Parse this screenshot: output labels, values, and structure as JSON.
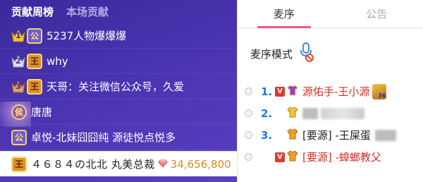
{
  "left_tabs": {
    "contribution_week": "贡献周榜",
    "this_show": "本场贡献"
  },
  "ranking": [
    {
      "rank": "1",
      "level_icon": "crown-badge",
      "level_text": "公",
      "name": "5237人物爆爆爆"
    },
    {
      "rank": "2",
      "level_icon": "king-badge",
      "level_text": "王",
      "name": "why"
    },
    {
      "rank": "3",
      "level_icon": "king-badge",
      "level_text": "王",
      "name": "天哥：关注微信公众号，久爱"
    },
    {
      "rank": "",
      "level_icon": "marquis-badge",
      "level_text": "侯",
      "name": "唐唐"
    },
    {
      "rank": "",
      "level_icon": "duke-badge",
      "level_text": "公",
      "name": "卓悦-北妹囧囧纯 源徒悦点悦多"
    }
  ],
  "my_row": {
    "level_text": "王",
    "name": "４６８４の北北 丸美总裁",
    "gem_icon": "gem-icon",
    "score": "34,656,800"
  },
  "right_tabs": {
    "queue": "麦序",
    "notice": "公告"
  },
  "mode": {
    "label": "麦序模式",
    "icon": "mic-icon",
    "status_icon": "disabled-icon"
  },
  "queue": [
    {
      "num": "1.",
      "v": "V",
      "name": "源佑手-王小源",
      "name_color": "red",
      "extra": "king-badge-36"
    },
    {
      "num": "2.",
      "v": "",
      "name": "",
      "name_color": "dark",
      "extra": "blurred"
    },
    {
      "num": "3.",
      "v": "",
      "name": "[要源] -王屎蛋",
      "name_color": "dark",
      "extra": "blurred-tail"
    },
    {
      "num": "",
      "v": "V",
      "name": "[要源] -蟑螂教父",
      "name_color": "red",
      "extra": ""
    }
  ],
  "colors": {
    "panel_purple": "#4a33b0",
    "accent_pink": "#f05a7e",
    "queue_blue": "#1c7ae0",
    "score_gold": "#d98a25"
  }
}
